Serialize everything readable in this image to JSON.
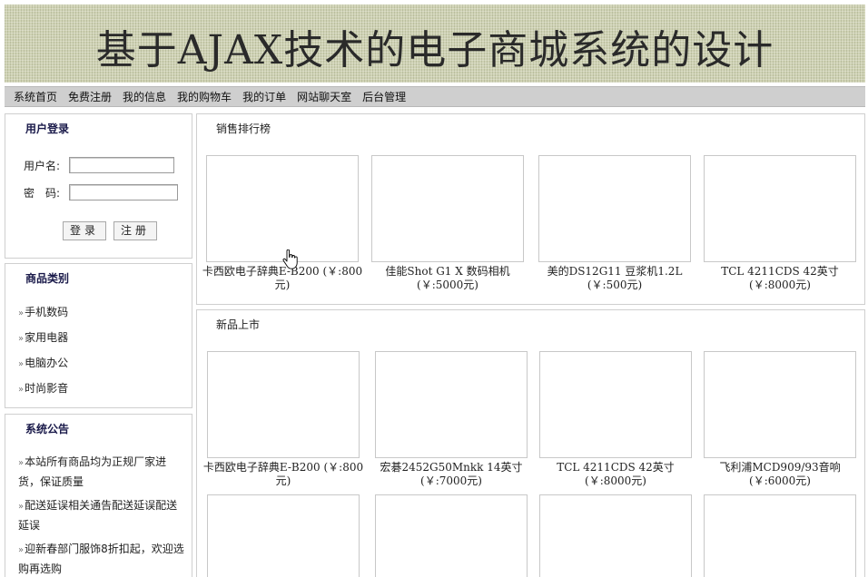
{
  "header": {
    "title": "基于AJAX技术的电子商城系统的设计"
  },
  "nav": {
    "items": [
      {
        "label": "系统首页"
      },
      {
        "label": "免费注册"
      },
      {
        "label": "我的信息"
      },
      {
        "label": "我的购物车"
      },
      {
        "label": "我的订单"
      },
      {
        "label": "网站聊天室"
      },
      {
        "label": "后台管理"
      }
    ]
  },
  "login": {
    "title": "用户登录",
    "username_label": "用户名:",
    "password_label": "密　码:",
    "username_value": "",
    "password_value": "",
    "login_button": "登录",
    "register_button": "注册"
  },
  "category": {
    "title": "商品类别",
    "items": [
      {
        "label": "手机数码"
      },
      {
        "label": "家用电器"
      },
      {
        "label": "电脑办公"
      },
      {
        "label": "时尚影音"
      }
    ]
  },
  "notice": {
    "title": "系统公告",
    "items": [
      {
        "label": "本站所有商品均为正规厂家进货，保证质量"
      },
      {
        "label": "配送延误相关通告配送延误配送延误"
      },
      {
        "label": "迎新春部门服饰8折扣起，欢迎选购再选购"
      }
    ]
  },
  "sales": {
    "title": "销售排行榜",
    "products": [
      {
        "caption": "卡西欧电子辞典E-B200 (￥:800元)"
      },
      {
        "caption": "佳能Shot G1 X 数码相机 (￥:5000元)"
      },
      {
        "caption": "美的DS12G11 豆浆机1.2L (￥:500元)"
      },
      {
        "caption": "TCL 4211CDS 42英寸 (￥:8000元)"
      }
    ]
  },
  "new_arrivals": {
    "title": "新品上市",
    "products": [
      {
        "caption": "卡西欧电子辞典E-B200 (￥:800元)"
      },
      {
        "caption": "宏碁2452G50Mnkk 14英寸 (￥:7000元)"
      },
      {
        "caption": "TCL 4211CDS 42英寸 (￥:8000元)"
      },
      {
        "caption": "飞利浦MCD909/93音响 (￥:6000元)"
      }
    ]
  },
  "icons": {
    "cursor": "hand-pointer-icon",
    "bullet": "double-chevron-right-icon"
  }
}
